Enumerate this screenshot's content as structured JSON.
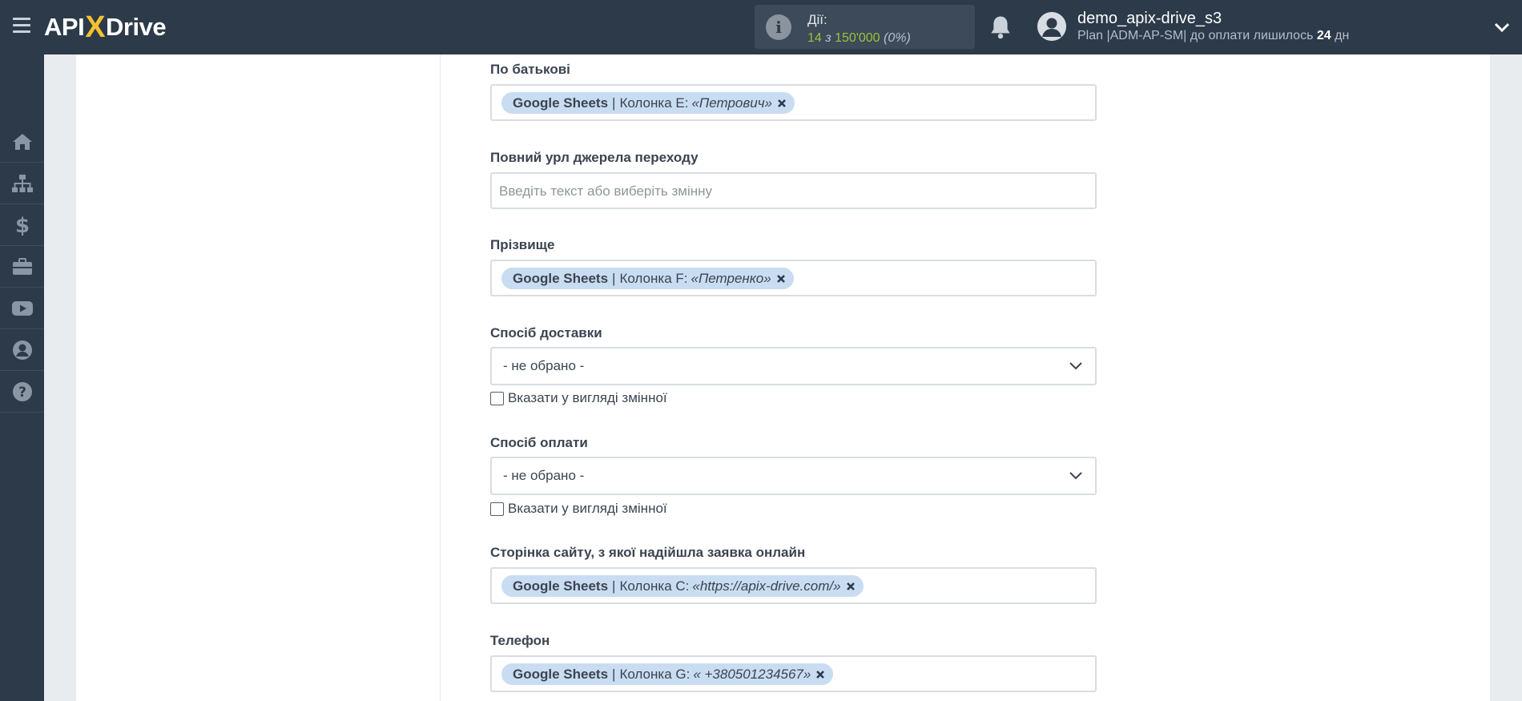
{
  "header": {
    "logo_left": "API",
    "logo_x": "X",
    "logo_right": "Drive",
    "actions_title": "Дії:",
    "actions_used": "14",
    "actions_sep": " з ",
    "actions_total": "150'000",
    "actions_percent": "(0%)",
    "user_name": "demo_apix-drive_s3",
    "plan_prefix": "Plan |ADM-AP-SM| до оплати лишилось ",
    "plan_days": "24",
    "plan_suffix": " дн"
  },
  "sidebar": {
    "items": [
      {
        "icon": "home-icon"
      },
      {
        "icon": "sitemap-icon"
      },
      {
        "icon": "dollar-icon"
      },
      {
        "icon": "briefcase-icon"
      },
      {
        "icon": "youtube-icon"
      },
      {
        "icon": "user-circle-icon"
      },
      {
        "icon": "question-icon"
      }
    ]
  },
  "form": {
    "patronymic": {
      "label": "По батькові",
      "tag_source": "Google Sheets",
      "tag_sep": "|",
      "tag_column": "Колонка E:",
      "tag_value": "«Петрович»"
    },
    "referrer_url": {
      "label": "Повний урл джерела переходу",
      "placeholder": "Введіть текст або виберіть змінну"
    },
    "surname": {
      "label": "Прізвище",
      "tag_source": "Google Sheets",
      "tag_sep": "|",
      "tag_column": "Колонка F:",
      "tag_value": "«Петренко»"
    },
    "delivery": {
      "label": "Спосіб доставки",
      "selected": "- не обрано -",
      "checkbox_label": "Вказати у вигляді змінної"
    },
    "payment": {
      "label": "Спосіб оплати",
      "selected": "- не обрано -",
      "checkbox_label": "Вказати у вигляді змінної"
    },
    "page": {
      "label": "Сторінка сайту, з якої надійшла заявка онлайн",
      "tag_source": "Google Sheets",
      "tag_sep": "|",
      "tag_column": "Колонка C:",
      "tag_value": "«https://apix-drive.com/»"
    },
    "phone": {
      "label": "Телефон",
      "tag_source": "Google Sheets",
      "tag_sep": "|",
      "tag_column": "Колонка G:",
      "tag_value": "« +380501234567»"
    }
  },
  "colors": {
    "topbar": "#2c3a49",
    "accent_green": "#9bc23a",
    "logo_x": "#f5c12e",
    "tag_bg": "#c9ddf2"
  }
}
